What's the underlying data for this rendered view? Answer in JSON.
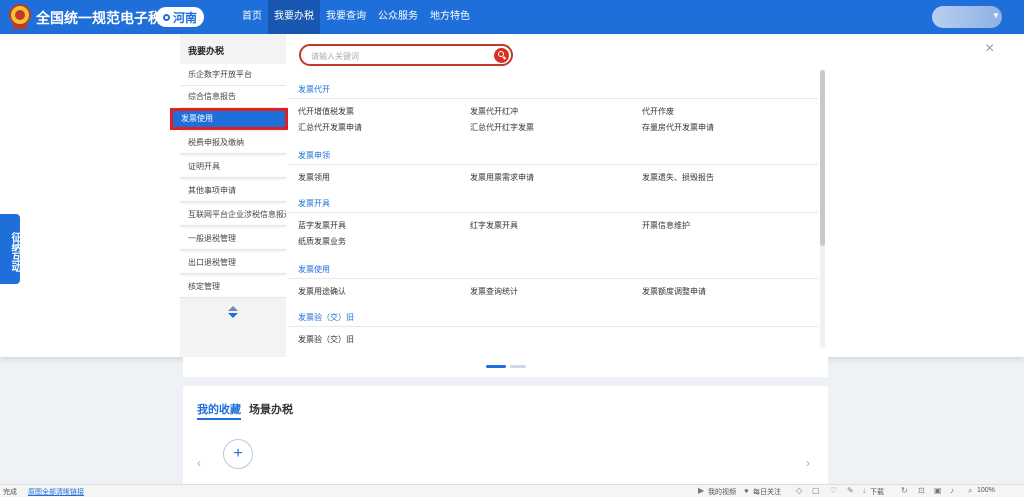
{
  "header": {
    "site_title": "全国统一规范电子税务局",
    "region": "河南",
    "nav": [
      "首页",
      "我要办税",
      "我要查询",
      "公众服务",
      "地方特色"
    ],
    "active_nav_index": 1
  },
  "category_menu": {
    "header": "我要办税",
    "items": [
      "乐企数字开放平台",
      "综合信息报告",
      "发票使用",
      "税费申报及缴纳",
      "证明开具",
      "其他事项申请",
      "互联网平台企业涉税信息报送",
      "一般退税管理",
      "出口退税管理",
      "核定管理"
    ],
    "selected_index": 2
  },
  "search": {
    "placeholder": "请输入关键词"
  },
  "sections": [
    {
      "title": "发票代开",
      "links": [
        "代开增值税发票",
        "发票代开红冲",
        "代开作废",
        "汇总代开发票申请",
        "汇总代开红字发票",
        "存量房代开发票申请"
      ]
    },
    {
      "title": "发票申领",
      "links": [
        "发票领用",
        "发票用票需求申请",
        "发票遗失、损毁报告"
      ]
    },
    {
      "title": "发票开具",
      "links": [
        "蓝字发票开具",
        "红字发票开具",
        "开票信息维护",
        "纸质发票业务"
      ]
    },
    {
      "title": "发票使用",
      "links": [
        "发票用途确认",
        "发票查询统计",
        "发票额度调整申请"
      ]
    },
    {
      "title": "发票验（交）旧",
      "links": [
        "发票验（交）旧"
      ]
    }
  ],
  "side_tab": {
    "text": "征纳互动"
  },
  "lower": {
    "tab_favorites": "我的收藏",
    "tab_scenes": "场景办税"
  },
  "statusbar": {
    "left": "完成",
    "link": "原图全部清晰链接",
    "items": [
      "我的视频",
      "每日关注",
      "下载",
      "100%"
    ]
  },
  "colors": {
    "brand_blue": "#1e6fd9",
    "highlight_red": "#e02020"
  }
}
